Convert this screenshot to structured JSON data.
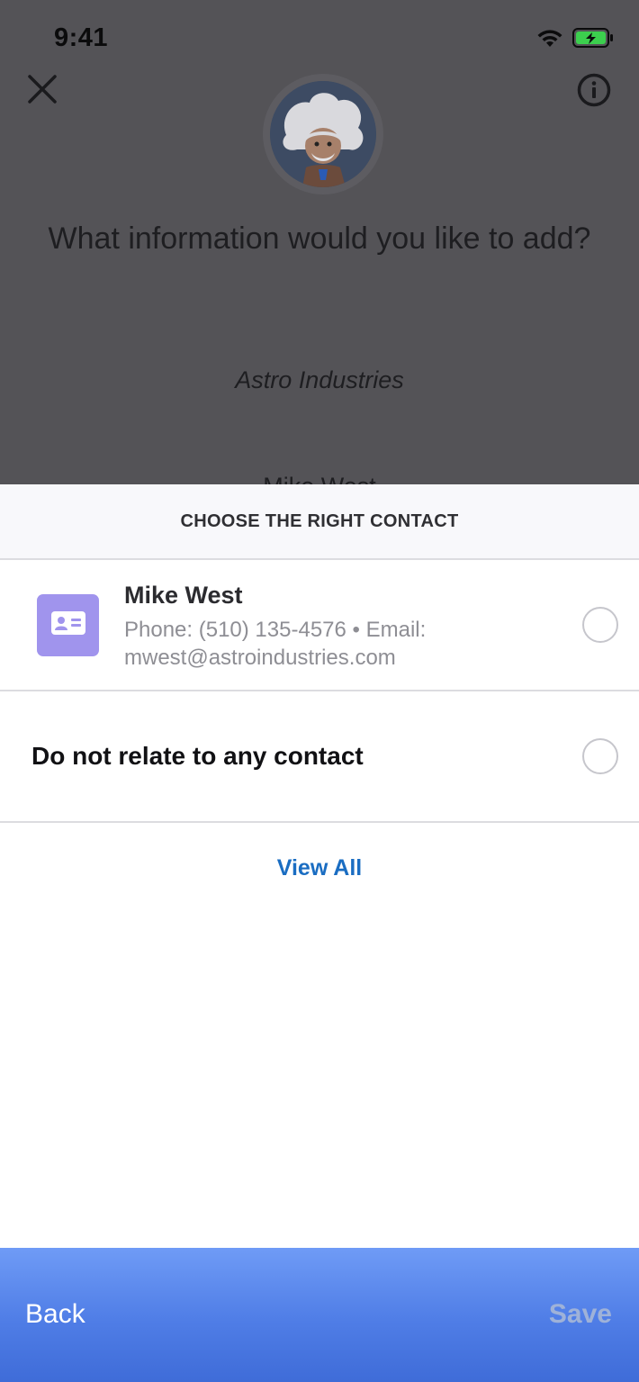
{
  "status_bar": {
    "time": "9:41"
  },
  "background_screen": {
    "question": "What information would you like to add?",
    "company": "Astro Industries",
    "peek_text": "Mike West"
  },
  "sheet": {
    "title": "CHOOSE THE RIGHT CONTACT",
    "contact": {
      "name": "Mike West",
      "details": "Phone: (510) 135-4576 • Email: mwest@astroindustries.com",
      "icon": "contact-card-icon"
    },
    "none_option": "Do not relate to any contact",
    "view_all": "View All"
  },
  "bottom_bar": {
    "back": "Back",
    "save": "Save"
  },
  "colors": {
    "accent": "#1a6dc2",
    "contact_badge": "#a094ed",
    "bottom_bar": "#4f7de6"
  }
}
